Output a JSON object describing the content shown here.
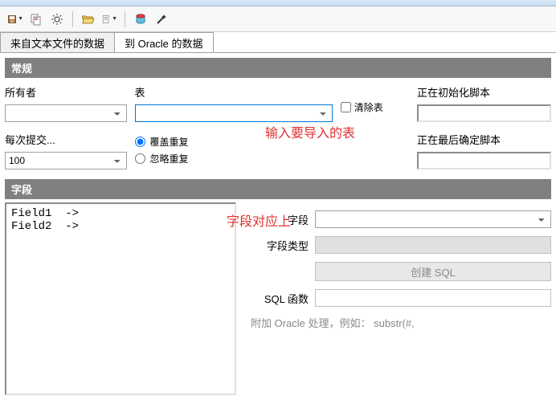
{
  "tabs": {
    "tab1": "来自文本文件的数据",
    "tab2": "到 Oracle 的数据"
  },
  "sections": {
    "general": "常规",
    "fields": "字段"
  },
  "general": {
    "owner_label": "所有者",
    "table_label": "表",
    "clear_table_label": "清除表",
    "init_script_label": "正在初始化脚本",
    "commit_label": "每次提交...",
    "commit_value": "100",
    "overwrite_dup_label": "覆盖重复",
    "ignore_dup_label": "忽略重复",
    "final_script_label": "正在最后确定脚本"
  },
  "annotations": {
    "input_table": "输入要导入的表",
    "field_match": "字段对应上"
  },
  "fields": {
    "list_text": "Field1  ->\nField2  ->",
    "field_label": "字段",
    "field_type_label": "字段类型",
    "create_sql_btn": "创建 SQL",
    "sql_func_label": "SQL 函数",
    "hint": "附加 Oracle 处理，例如： substr(#,"
  }
}
